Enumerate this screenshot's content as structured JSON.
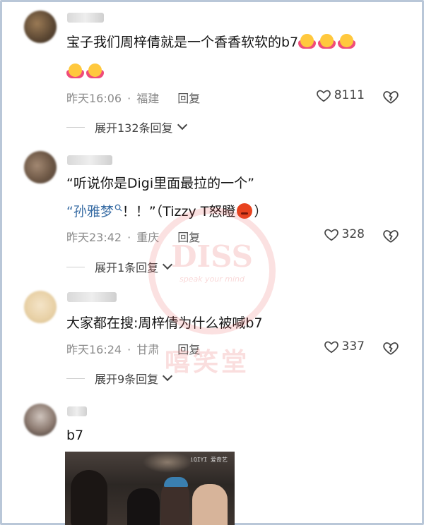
{
  "comments": [
    {
      "text": "宝子我们周梓倩就是一个香香软软的b7",
      "time": "昨天16:06",
      "location": "福建",
      "reply_label": "回复",
      "likes": "8111",
      "expand_label": "展开132条回复"
    },
    {
      "line1": "“听说你是Digi里面最拉的一个”",
      "mention": "“孙雅梦",
      "line2_rest": "！！”（Tizzy T怒瞪",
      "line2_end": "）",
      "time": "昨天23:42",
      "location": "重庆",
      "reply_label": "回复",
      "likes": "328",
      "expand_label": "展开1条回复"
    },
    {
      "text": "大家都在搜:周梓倩为什么被喊b7",
      "time": "昨天16:24",
      "location": "甘肃",
      "reply_label": "回复",
      "likes": "337",
      "expand_label": "展开9条回复"
    },
    {
      "text": "b7"
    }
  ],
  "watermark": {
    "main": "DISS",
    "sub": "speak your mind",
    "cn": "嘻笑堂"
  },
  "photo": {
    "logo": "iQIYI 爱奇艺"
  },
  "colors": {
    "meta": "#8a8a8a",
    "mention": "#3a6ea5",
    "watermark": "#e14646"
  }
}
